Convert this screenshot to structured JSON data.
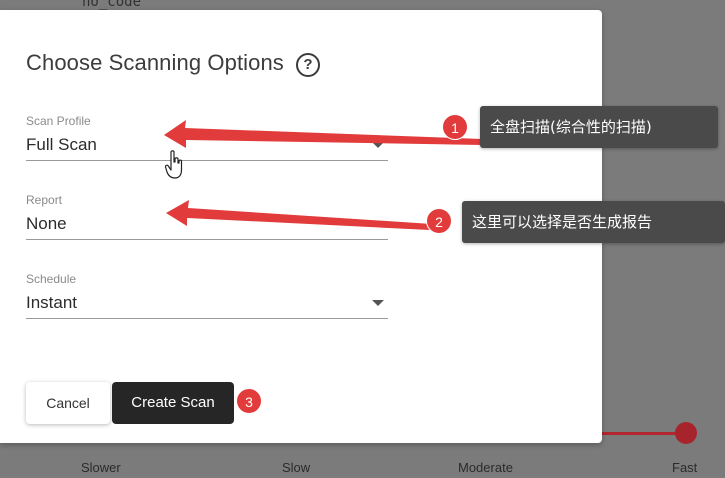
{
  "background": {
    "top_text": "no_code",
    "speed_labels": [
      "Slower",
      "Slow",
      "Moderate",
      "Fast"
    ],
    "accent_color": "#a8242c"
  },
  "dialog": {
    "title": "Choose Scanning Options",
    "help_icon": "question-circle-icon",
    "fields": {
      "scan_profile": {
        "label": "Scan Profile",
        "value": "Full Scan"
      },
      "report": {
        "label": "Report",
        "value": "None"
      },
      "schedule": {
        "label": "Schedule",
        "value": "Instant"
      }
    },
    "buttons": {
      "cancel": "Cancel",
      "create": "Create Scan"
    }
  },
  "annotations": [
    {
      "number": "1",
      "text": "全盘扫描(综合性的扫描)"
    },
    {
      "number": "2",
      "text": "这里可以选择是否生成报告"
    },
    {
      "number": "3"
    }
  ],
  "colors": {
    "arrow_red": "#e23b3b",
    "callout_bg": "#4a4a4a",
    "primary_button": "#262626"
  }
}
